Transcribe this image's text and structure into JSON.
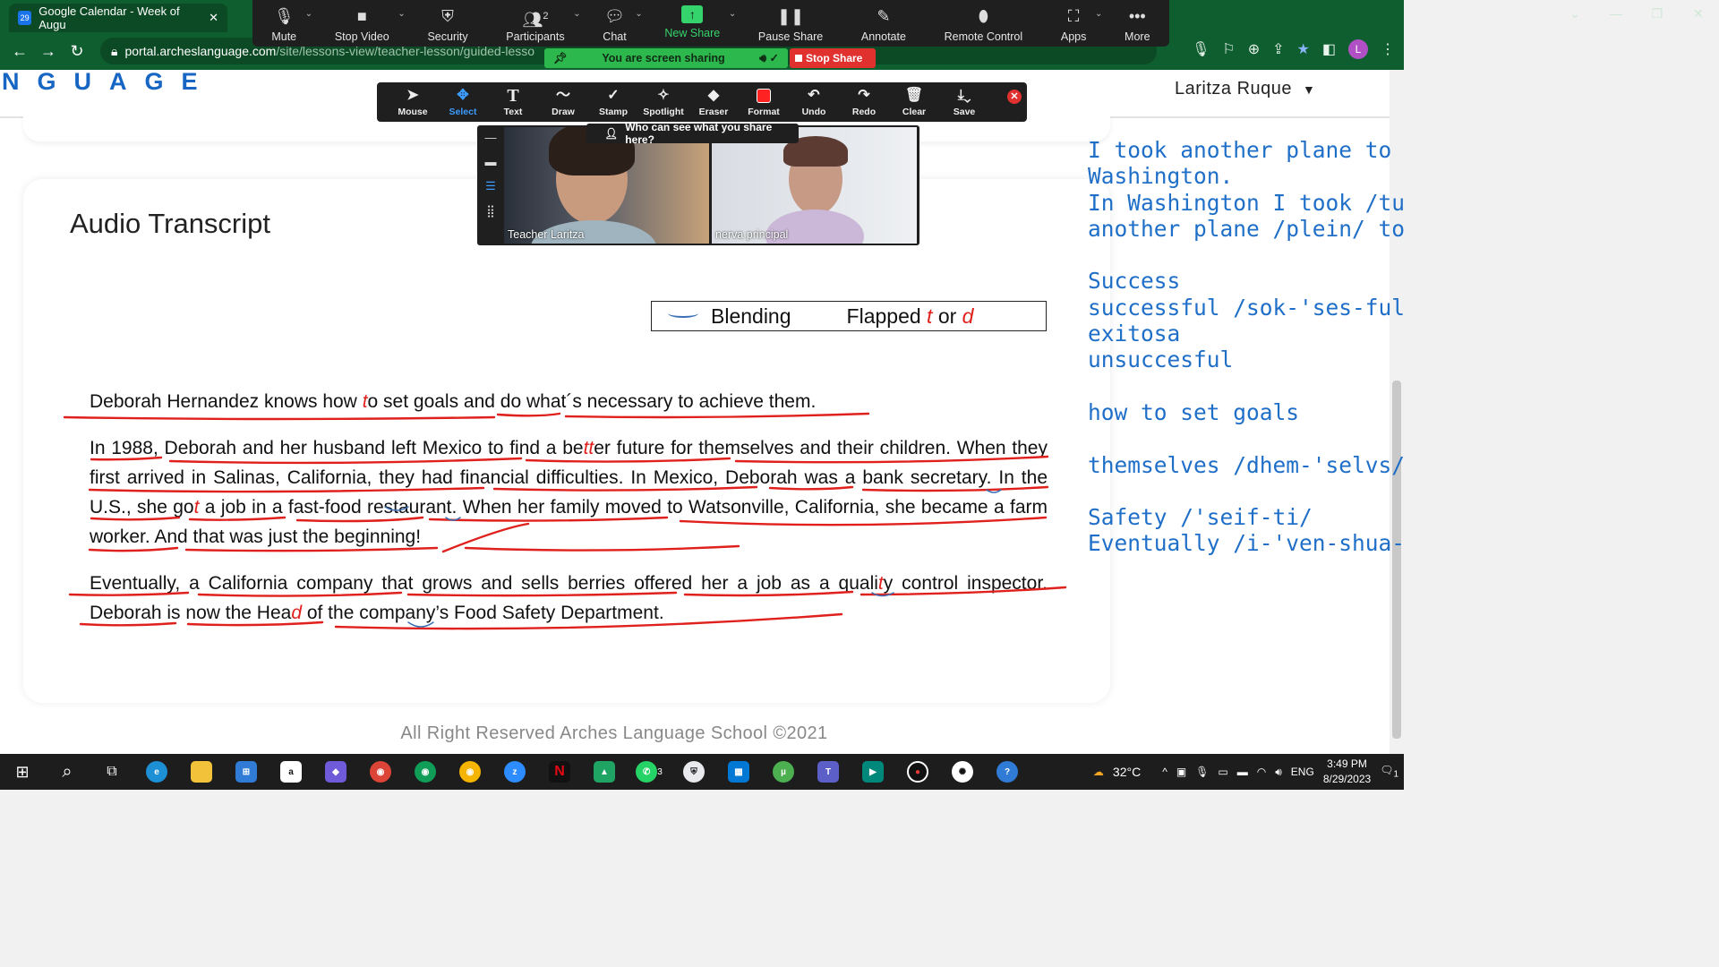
{
  "browser": {
    "tab_title": "Google Calendar - Week of Augu",
    "tab_favicon": "29",
    "url_host": "portal.archeslanguage.com",
    "url_path": "/site/lessons-view/teacher-lesson/guided-lesso",
    "profile_initial": "L"
  },
  "zoom": {
    "toolbar": [
      {
        "label": "Mute",
        "icon": "mic-icon"
      },
      {
        "label": "Stop Video",
        "icon": "video-camera-icon"
      },
      {
        "label": "Security",
        "icon": "shield-icon"
      },
      {
        "label": "Participants",
        "icon": "people-icon",
        "count": "2"
      },
      {
        "label": "Chat",
        "icon": "chat-bubble-icon"
      },
      {
        "label": "New Share",
        "icon": "share-arrow-icon"
      },
      {
        "label": "Pause Share",
        "icon": "pause-icon"
      },
      {
        "label": "Annotate",
        "icon": "pen-icon"
      },
      {
        "label": "Remote Control",
        "icon": "mouse-icon"
      },
      {
        "label": "Apps",
        "icon": "apps-icon"
      },
      {
        "label": "More",
        "icon": "more-dots-icon"
      }
    ],
    "sharing_status": "You are screen sharing",
    "stop_share": "Stop Share",
    "annotate_tools": [
      {
        "label": "Mouse",
        "icon": "cursor-icon"
      },
      {
        "label": "Select",
        "icon": "move-icon",
        "selected": true
      },
      {
        "label": "Text",
        "icon": "text-icon"
      },
      {
        "label": "Draw",
        "icon": "squiggle-icon"
      },
      {
        "label": "Stamp",
        "icon": "check-stamp-icon"
      },
      {
        "label": "Spotlight",
        "icon": "wand-icon"
      },
      {
        "label": "Eraser",
        "icon": "eraser-icon"
      },
      {
        "label": "Format",
        "icon": "color-swatch-icon"
      },
      {
        "label": "Undo",
        "icon": "undo-icon"
      },
      {
        "label": "Redo",
        "icon": "redo-icon"
      },
      {
        "label": "Clear",
        "icon": "trash-icon"
      },
      {
        "label": "Save",
        "icon": "save-icon"
      }
    ],
    "who_can_see": "Who can see what you share here?",
    "participants": [
      {
        "name": "Teacher Laritza"
      },
      {
        "name": "nerva principal"
      }
    ]
  },
  "site": {
    "logo": "NGUAGE",
    "user_name": "Laritza Ruque"
  },
  "transcript": {
    "title": "Audio Transcript",
    "legend": {
      "blending": "Blending",
      "flapped_prefix": "Flapped",
      "t": "t",
      "or": "or",
      "d": "d"
    },
    "p1": {
      "a": "Deborah Hernandez knows how ",
      "t": "t",
      "b": "o set goals and do what´s necessary to achieve them."
    },
    "p2": {
      "a": "In 1988, Deborah and her husband left Mexico to find a be",
      "tt": "tt",
      "b": "er future for themselves and their children. When they first arrived in Salinas, California, they had financial difficulties. In Mexico, Deborah was a bank secretary. In the U.S., she go",
      "t": "t",
      "c": " a job in a fast-food restaurant. When her family moved to Watsonville, California, she became a farm worker. And that was just the beginning!"
    },
    "p3": {
      "a": "Eventually, a California company that grows and sells berries offered her a job as a quali",
      "t": "t",
      "b": "y control inspector. Deborah is now the Hea",
      "d": "d",
      "c": " of the company’s Food Safety Department."
    }
  },
  "footer": "All Right Reserved Arches Language School ©2021",
  "notes": "I took another plane to\nWashington.\nIn Washington I took /tuk/\nanother plane /plein/ to Virg\n\nSuccess\nsuccessful /sok-'ses-ful/ =\nexitosa\nunsuccesful\n\nhow to set goals\n\nthemselves /dhem-'selvs/\n\nSafety /'seif-ti/\nEventually /i-'ven-shua-li/",
  "taskbar": {
    "weather": "32°C",
    "lang": "ENG",
    "time": "3:49 PM",
    "date": "8/29/2023",
    "notif_count": "1",
    "whatsapp_badge": "3"
  },
  "colors": {
    "accent_blue": "#1f6fc8",
    "annotation_red": "#e0201c",
    "zoom_green": "#2db84e",
    "chrome_green": "#0f5e2f"
  }
}
